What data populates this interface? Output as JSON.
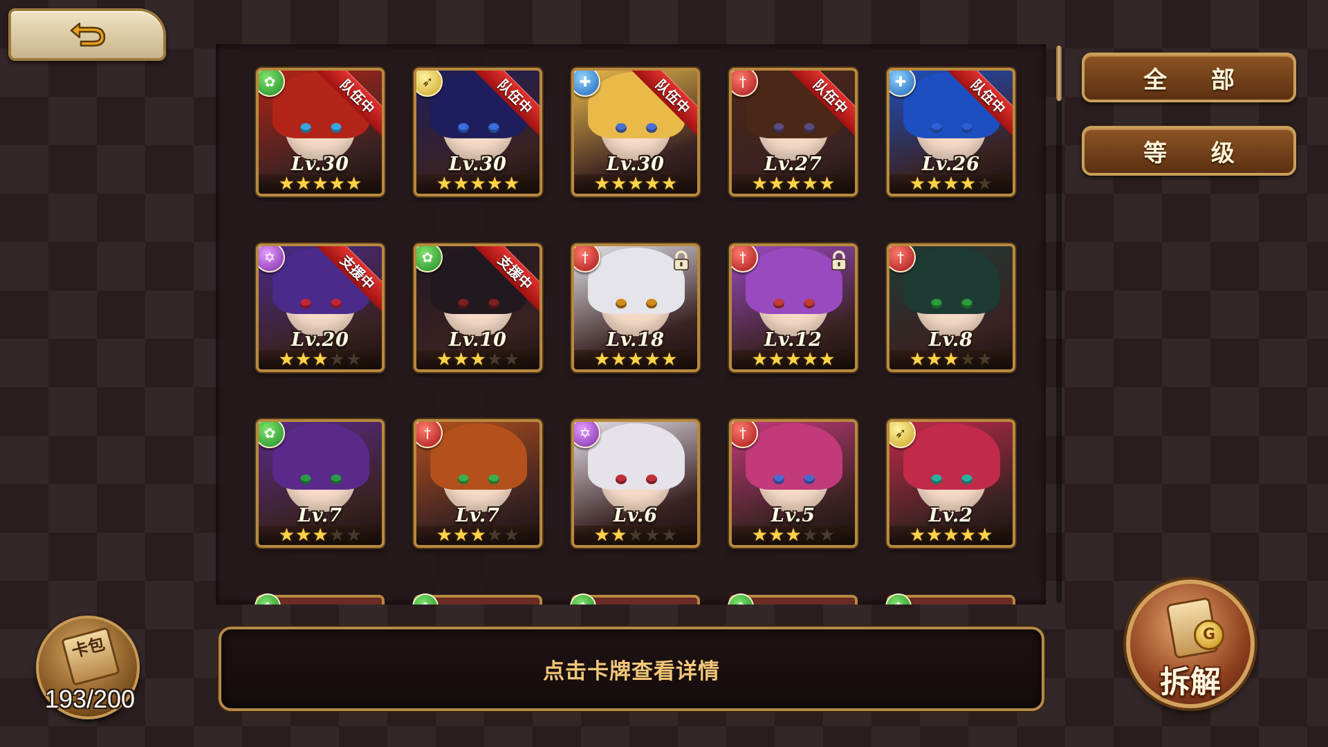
{
  "cards": [
    {
      "level": "Lv.30",
      "stars": 5,
      "max_stars": 5,
      "type": "green",
      "type_icon": "leaf-element-icon",
      "ribbon": "队伍中",
      "locked": false,
      "hair": "#b32418",
      "eye": "#3aa6e0"
    },
    {
      "level": "Lv.30",
      "stars": 5,
      "max_stars": 5,
      "type": "yellow",
      "type_icon": "bow-element-icon",
      "ribbon": "队伍中",
      "locked": false,
      "hair": "#1f1e5c",
      "eye": "#3a6fe0"
    },
    {
      "level": "Lv.30",
      "stars": 5,
      "max_stars": 5,
      "type": "blue",
      "type_icon": "shield-element-icon",
      "ribbon": "队伍中",
      "locked": false,
      "hair": "#e9b949",
      "eye": "#4a6fd0"
    },
    {
      "level": "Lv.27",
      "stars": 5,
      "max_stars": 5,
      "type": "red",
      "type_icon": "sword-element-icon",
      "ribbon": "队伍中",
      "locked": false,
      "hair": "#4b2718",
      "eye": "#5a4a80"
    },
    {
      "level": "Lv.26",
      "stars": 4,
      "max_stars": 5,
      "type": "blue",
      "type_icon": "shield-element-icon",
      "ribbon": "队伍中",
      "locked": false,
      "hair": "#1d4fc0",
      "eye": "#2d5fd6"
    },
    {
      "level": "Lv.20",
      "stars": 3,
      "max_stars": 5,
      "type": "purple",
      "type_icon": "hexagram-element-icon",
      "ribbon": "支援中",
      "locked": false,
      "hair": "#4a2a8a",
      "eye": "#c0263a"
    },
    {
      "level": "Lv.10",
      "stars": 3,
      "max_stars": 5,
      "type": "green",
      "type_icon": "leaf-element-icon",
      "ribbon": "支援中",
      "locked": false,
      "hair": "#221820",
      "eye": "#7a2020"
    },
    {
      "level": "Lv.18",
      "stars": 5,
      "max_stars": 5,
      "type": "red",
      "type_icon": "sword-element-icon",
      "ribbon": "",
      "locked": true,
      "hair": "#e4e4ea",
      "eye": "#d08a1a"
    },
    {
      "level": "Lv.12",
      "stars": 5,
      "max_stars": 5,
      "type": "red",
      "type_icon": "sword-element-icon",
      "ribbon": "",
      "locked": true,
      "hair": "#9a4ac0",
      "eye": "#c03a3a"
    },
    {
      "level": "Lv.8",
      "stars": 3,
      "max_stars": 5,
      "type": "red",
      "type_icon": "sword-element-icon",
      "ribbon": "",
      "locked": false,
      "hair": "#1e3a34",
      "eye": "#2a9a3a"
    },
    {
      "level": "Lv.7",
      "stars": 3,
      "max_stars": 5,
      "type": "green",
      "type_icon": "leaf-element-icon",
      "ribbon": "",
      "locked": false,
      "hair": "#5a2a8a",
      "eye": "#2a9a4a"
    },
    {
      "level": "Lv.7",
      "stars": 3,
      "max_stars": 5,
      "type": "red",
      "type_icon": "sword-element-icon",
      "ribbon": "",
      "locked": false,
      "hair": "#b3501c",
      "eye": "#3ab04a"
    },
    {
      "level": "Lv.6",
      "stars": 2,
      "max_stars": 5,
      "type": "purple",
      "type_icon": "hexagram-element-icon",
      "ribbon": "",
      "locked": false,
      "hair": "#e6e2ea",
      "eye": "#c0303a"
    },
    {
      "level": "Lv.5",
      "stars": 3,
      "max_stars": 5,
      "type": "red",
      "type_icon": "sword-element-icon",
      "ribbon": "",
      "locked": false,
      "hair": "#c23a7a",
      "eye": "#4a6ad0"
    },
    {
      "level": "Lv.2",
      "stars": 5,
      "max_stars": 5,
      "type": "yellow",
      "type_icon": "bow-element-icon",
      "ribbon": "",
      "locked": false,
      "hair": "#c22a4a",
      "eye": "#2ab0a0"
    }
  ],
  "peek_types": [
    "green",
    "green",
    "green",
    "green",
    "green"
  ],
  "filters": {
    "all": "全 部",
    "level": "等 级"
  },
  "info_text": "点击卡牌查看详情",
  "card_pack": {
    "label": "卡包",
    "count": "193/200"
  },
  "dismantle": {
    "label": "拆解",
    "coin": "G"
  },
  "colors": {
    "accent_gold": "#b8893e",
    "info_text": "#f2c77a",
    "ribbon_red": "#e0322f"
  }
}
